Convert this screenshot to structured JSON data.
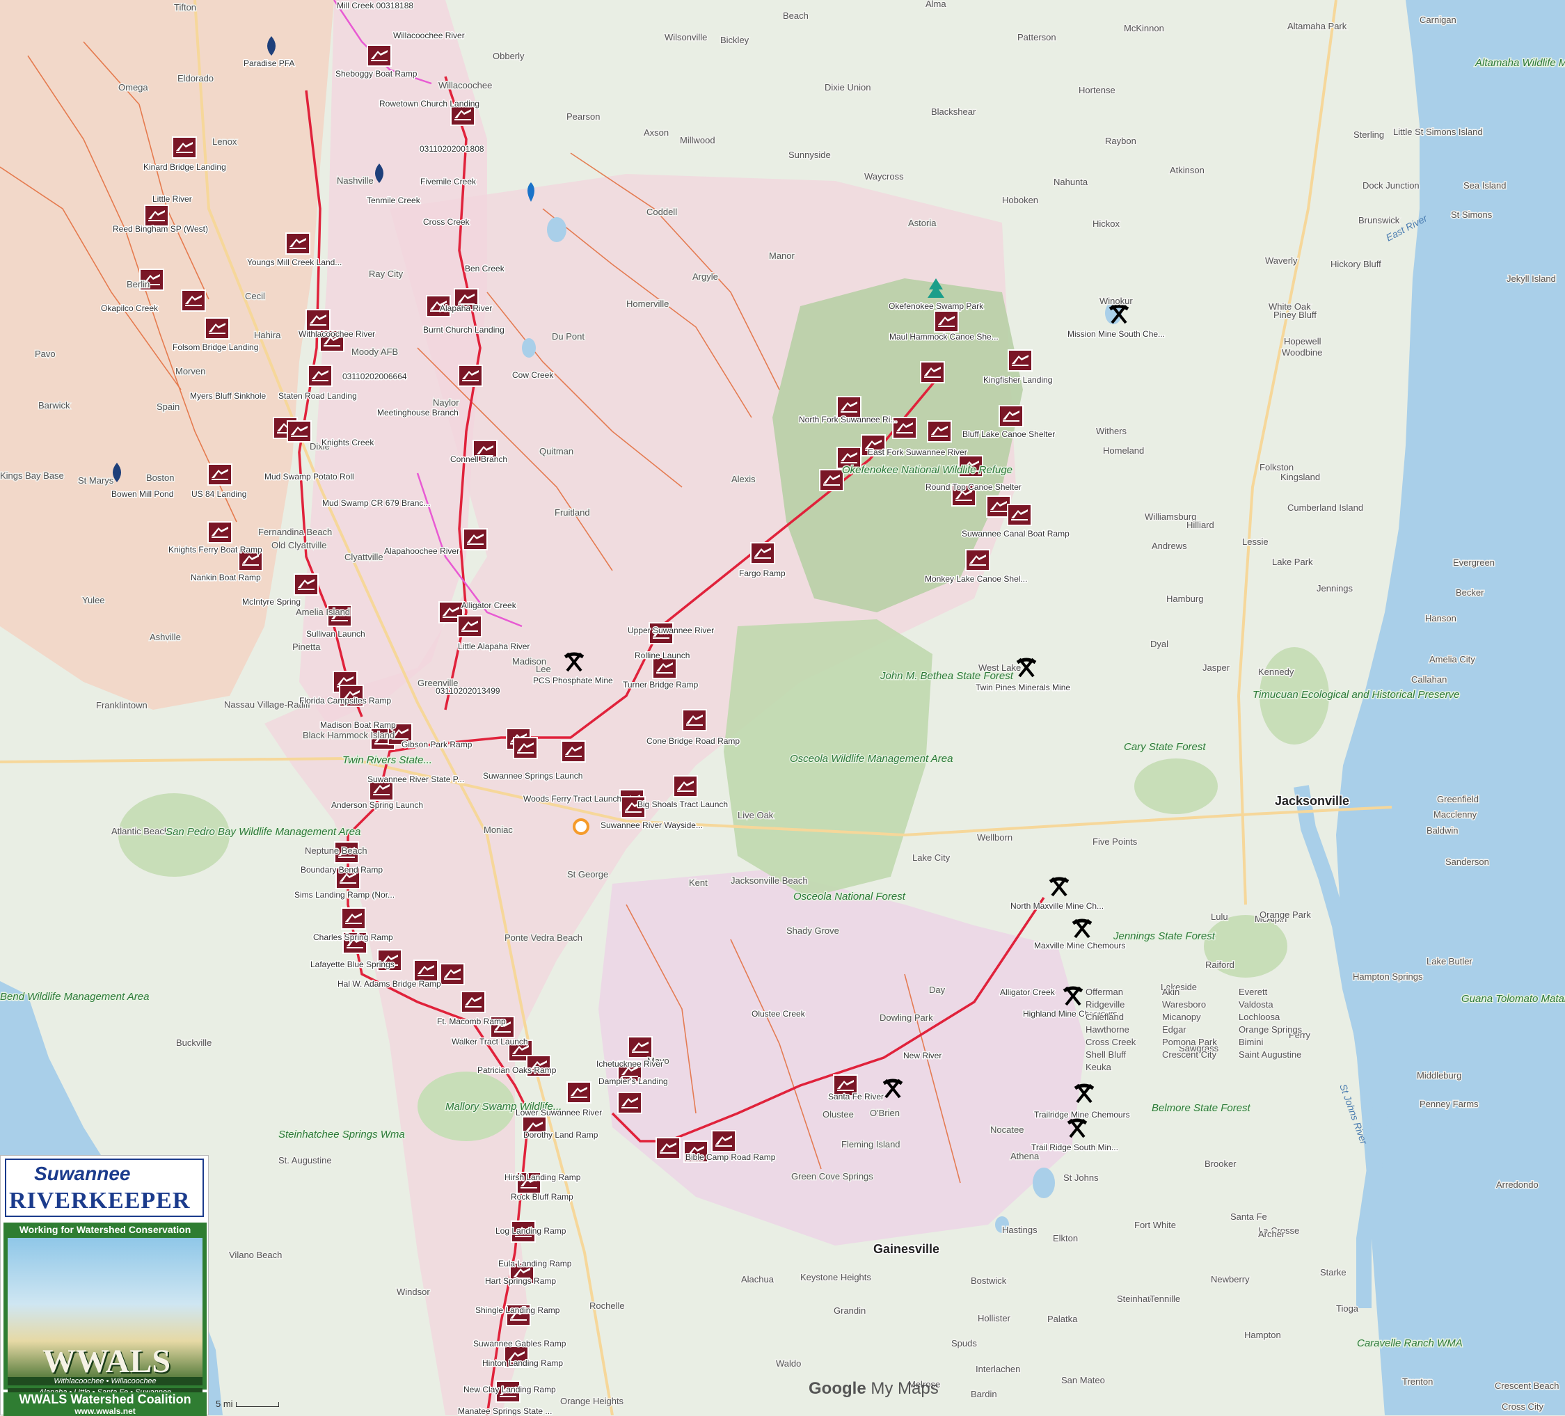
{
  "map": {
    "attribution_brand": "Google",
    "attribution_product": "My Maps",
    "scale_label": "5 mi",
    "colors": {
      "land": "#e9eee4",
      "basin_pink": "#f2d6de",
      "basin_orange": "#f3d3c4",
      "forest_green": "#c8deb8",
      "water": "#a9cfe9",
      "river_red": "#e0223b",
      "trib_orange": "#e36b3a",
      "ramp_marker": "#7a1626",
      "mine_icon": "#000000"
    },
    "cities": [
      "Jacksonville",
      "Gainesville"
    ],
    "towns": [
      "Tifton",
      "Beach",
      "Alma",
      "Bickley",
      "Offerman",
      "Patterson",
      "McKinnon",
      "Altamaha Park",
      "Akin",
      "Carnigan",
      "Everett",
      "Ridgeville",
      "Wilsonville",
      "Obberly",
      "Dixie Union",
      "Blackshear",
      "Hortense",
      "Omega",
      "Eldorado",
      "Willacoochee",
      "Pearson",
      "Axson",
      "Millwood",
      "Waresboro",
      "Sunnyside",
      "Waycross",
      "Raybon",
      "Atkinson",
      "Sterling",
      "Little St Simons Island",
      "Sea Island",
      "Dock Junction",
      "Brunswick",
      "St Simons",
      "Lenox",
      "Nashville",
      "Hoboken",
      "Hickox",
      "Nahunta",
      "Astoria",
      "Coddell",
      "Ray City",
      "Argyle",
      "Manor",
      "Waverly",
      "Hickory Bluff",
      "Jekyll Island",
      "Berlin",
      "Cecil",
      "Hahira",
      "Moody AFB",
      "Winokur",
      "White Oak",
      "Piney Bluff",
      "Homerville",
      "Du Pont",
      "Hopewell",
      "Woodbine",
      "Pavo",
      "Morven",
      "Barwick",
      "Spain",
      "Naylor",
      "Withers",
      "Homeland",
      "Folkston",
      "Kingsland",
      "Cumberland Island",
      "Kings Bay Base",
      "St Marys",
      "Boston",
      "Dixie",
      "Quitman",
      "Valdosta",
      "Fruitland",
      "Alexis",
      "Williamsburg",
      "Andrews",
      "Hilliard",
      "Lessie",
      "Evergreen",
      "Fernandina Beach",
      "Old Clyattville",
      "Clyattville",
      "Lake Park",
      "Jennings",
      "Becker",
      "Yulee",
      "Amelia Island",
      "Ashville",
      "Pinetta",
      "Hamburg",
      "Hanson",
      "Dyal",
      "Amelia City",
      "Callahan",
      "Franklintown",
      "Nassau Village-Ratliff",
      "Black Hammock Island",
      "Greenville",
      "Madison",
      "Lee",
      "West Lake",
      "Jasper",
      "Kennedy",
      "Moniac",
      "St George",
      "Kent",
      "Live Oak",
      "Wellborn",
      "Five Points",
      "Lake City",
      "Greenfield",
      "Macclenny",
      "Baldwin",
      "Sanderson",
      "Atlantic Beach",
      "Neptune Beach",
      "Jacksonville Beach",
      "Ponte Vedra Beach",
      "Shady Grove",
      "Day",
      "Dowling Park",
      "McAlpin",
      "Lulu",
      "Raiford",
      "Lake Butler",
      "Orange Park",
      "Lakeside",
      "Sawgrass",
      "Perry",
      "Hampton Springs",
      "Buckville",
      "Mayo",
      "O'Brien",
      "Olustee",
      "Fleming Island",
      "Nocatee",
      "Middleburg",
      "Penney Farms",
      "Green Cove Springs",
      "St Johns",
      "Athena",
      "Fort White",
      "Brooker",
      "Santa Fe",
      "La Crosse",
      "Hampton",
      "Starke",
      "Vilano Beach",
      "St. Augustine",
      "Alachua",
      "Keystone Heights",
      "Waldo",
      "Grandin",
      "Bostwick",
      "Spuds",
      "Hastings",
      "Elkton",
      "Steinhatchee",
      "Tennille",
      "Newberry",
      "Tioga",
      "Archer",
      "Arredondo",
      "Windsor",
      "Rochelle",
      "Orange Heights",
      "Melrose",
      "Interlachen",
      "Hollister",
      "Palatka",
      "San Mateo",
      "Bardin",
      "Crescent Beach",
      "Cross City",
      "Trenton",
      "Chiefland",
      "Micanopy",
      "Lochloosa",
      "Hawthorne",
      "Edgar",
      "Orange Springs",
      "Cross Creek",
      "Pomona Park",
      "Bimini",
      "Shell Bluff",
      "Crescent City",
      "Saint Augustine",
      "Keuka"
    ],
    "parks": [
      "Altamaha Wildlife Management Area",
      "Okefenokee National Wildlife Refuge",
      "John M. Bethea State Forest",
      "Osceola Wildlife Management Area",
      "Osceola National Forest",
      "Cary State Forest",
      "Jennings State Forest",
      "Belmore State Forest",
      "San Pedro Bay Wildlife Management Area",
      "Mallory Swamp Wildlife...",
      "Steinhatchee Springs Wma",
      "Timucuan Ecological and Historical Preserve",
      "Guana Tolomato Matanzas National...",
      "Caravelle Ranch WMA",
      "Twin Rivers State...",
      "Bend Wildlife Management Area"
    ],
    "water_labels": [
      "East River",
      "St Johns River"
    ],
    "markers": {
      "boat_ramps": [
        "Willacoochee River",
        "Sheboggy Boat Ramp",
        "Rowetown Church Landing",
        "03110202001808",
        "Kinard Bridge Landing",
        "Little River",
        "Reed Bingham SP (West)",
        "Cross Creek",
        "Youngs Mill Creek Land...",
        "Ben Creek",
        "Okapilco Creek",
        "Alapaha River",
        "Burnt Church Landing",
        "Withlacoochee River",
        "Folsom Bridge Landing",
        "03110202006664",
        "Staten Road Landing",
        "Cow Creek",
        "Meetinghouse Branch",
        "Knights Creek",
        "Connell Branch",
        "Mud Swamp Potato Roll",
        "US 84 Landing",
        "Mud Swamp CR 679 Branc...",
        "Knights Ferry Boat Ramp",
        "Alapahoochee River",
        "Nankin Boat Ramp",
        "McIntyre Spring",
        "Sullivan Launch",
        "Alligator Creek",
        "Little Alapaha River",
        "Florida Campsites Ramp",
        "Madison Boat Ramp",
        "03110202013499",
        "Gibson Park Ramp",
        "Suwannee River State P...",
        "Anderson Spring Launch",
        "Upper Suwannee River",
        "Rolline Launch",
        "Turner Bridge Ramp",
        "Cone Bridge Road Ramp",
        "Suwannee Springs Launch",
        "Woods Ferry Tract Launch",
        "Big Shoals Tract Launch",
        "Suwannee River Wayside...",
        "Fargo Ramp",
        "Okefenokee Swamp Park",
        "Maul Hammock Canoe She...",
        "Kingfisher Landing",
        "North Fork Suwannee Ri...",
        "Bluff Lake Canoe Shelter",
        "East Fork Suwannee River",
        "Round Top Canoe Shelter",
        "Suwannee Canal Boat Ramp",
        "Monkey Lake Canoe Shel...",
        "Boundary Bend Ramp",
        "Sims Landing Ramp (Nor...",
        "Charles Spring Ramp",
        "Lafayette Blue Springs",
        "Hal W. Adams Bridge Ramp",
        "Ft. Macomb Ramp",
        "Walker Tract Launch",
        "Patrician Oaks Ramp",
        "Ichetucknee River",
        "Dampier's Landing",
        "Lower Suwannee River",
        "Dorothy Land Ramp",
        "Bible Camp Road Ramp",
        "Santa Fe River",
        "Hirsh Landing Ramp",
        "Rock Bluff Ramp",
        "Log Landing Ramp",
        "Eula Landing Ramp",
        "Hart Springs Ramp",
        "Shingle Landing Ramp",
        "Suwannee Gables Ramp",
        "Hinton Landing Ramp",
        "New Clay Landing Ramp",
        "Manatee Springs State ..."
      ],
      "mines": [
        "Mission Mine South Che...",
        "PCS Phosphate Mine",
        "Twin Pines Minerals Mine",
        "North Maxville Mine Ch...",
        "Maxville Mine Chemours",
        "Alligator Creek",
        "Highland Mine Chemours",
        "Trailridge Mine Chemours",
        "Trail Ridge South Min..."
      ],
      "other": [
        "Mill Creek 00318188",
        "Paradise PFA",
        "Fivemile Creek",
        "Tenmile Creek",
        "Myers Bluff Sinkhole",
        "Bowen Mill Pond",
        "New River",
        "Olustee Creek"
      ]
    }
  },
  "logo": {
    "line1": "Suwannee",
    "line2": "RIVERKEEPER",
    "tagline": "Working for Watershed Conservation",
    "acronym": "WWALS",
    "rivers1": "Withlacoochee • Willacoochee",
    "rivers2": "Alapaha • Little • Santa Fe • Suwannee",
    "coalition": "WWALS Watershed Coalition",
    "url": "www.wwals.net"
  }
}
